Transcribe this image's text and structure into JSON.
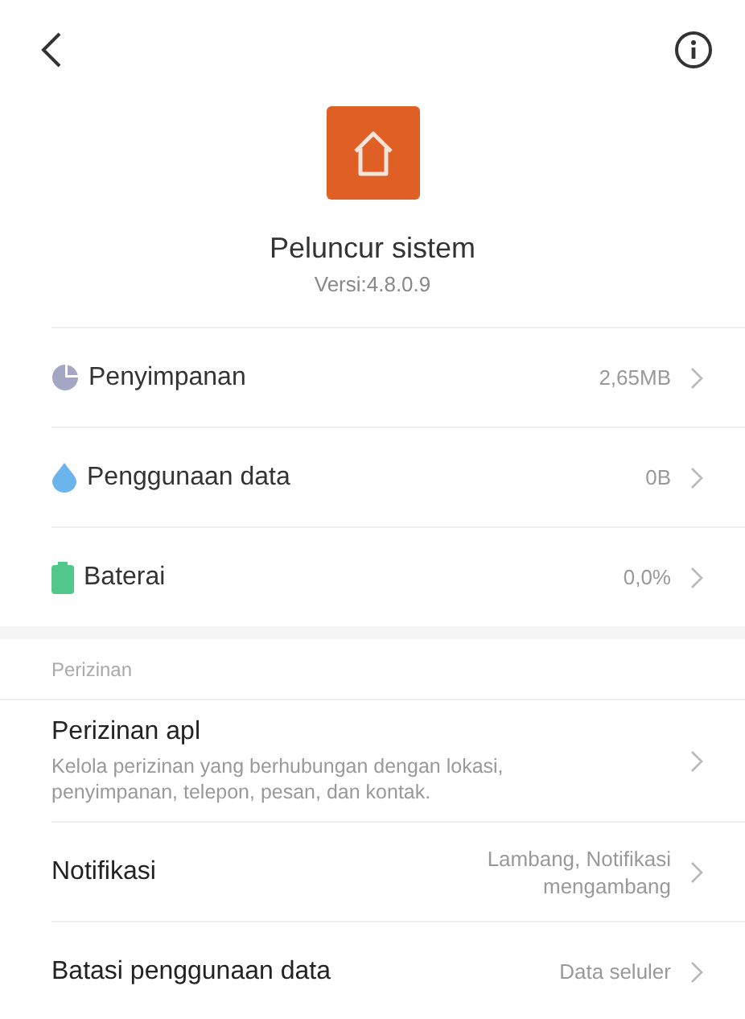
{
  "app": {
    "name": "Peluncur sistem",
    "version": "Versi:4.8.0.9"
  },
  "stats": [
    {
      "kind": "storage",
      "label": "Penyimpanan",
      "value": "2,65MB"
    },
    {
      "kind": "data",
      "label": "Penggunaan data",
      "value": "0B"
    },
    {
      "kind": "battery",
      "label": "Baterai",
      "value": "0,0%"
    }
  ],
  "permissions": {
    "header": "Perizinan",
    "items": [
      {
        "title": "Perizinan apl",
        "description": "Kelola perizinan yang berhubungan dengan lokasi, penyimpanan, telepon, pesan, dan kontak."
      },
      {
        "title": "Notifikasi",
        "value": "Lambang, Notifikasi mengambang"
      },
      {
        "title": "Batasi penggunaan data",
        "value": "Data seluler"
      }
    ]
  }
}
